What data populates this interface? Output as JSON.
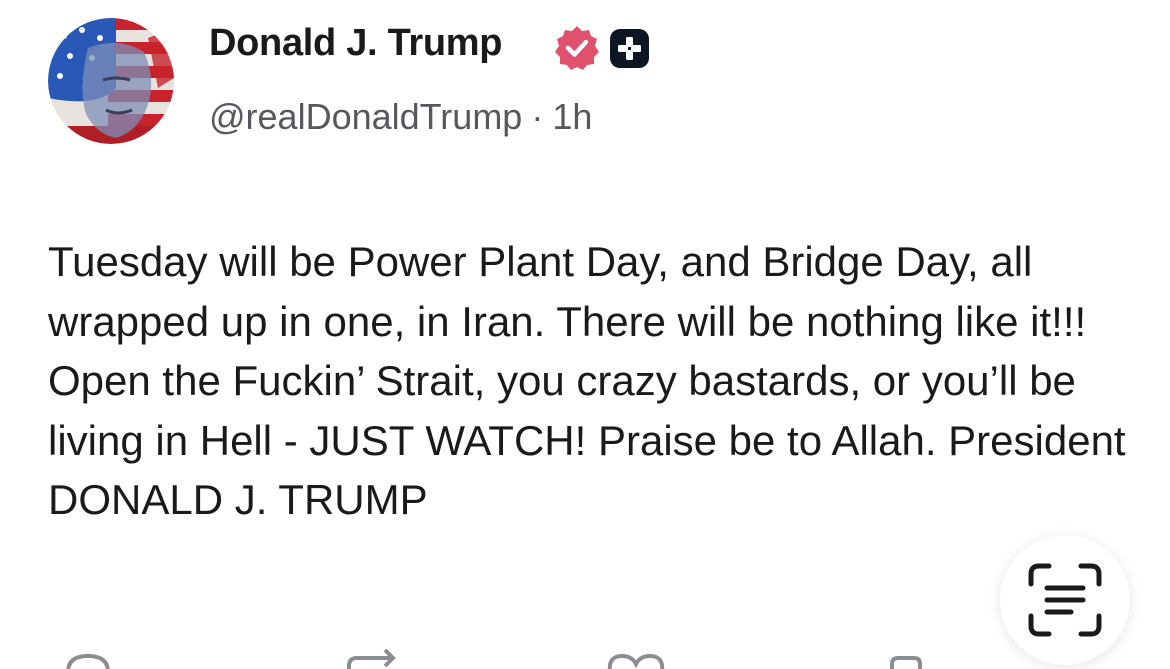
{
  "post": {
    "author": {
      "display_name": "Donald J. Trump",
      "handle": "@realDonaldTrump",
      "separator": "·",
      "time_ago": "1h",
      "avatar": "avatar-image",
      "badges": [
        "verified-badge-icon",
        "plus-badge-icon"
      ]
    },
    "body": "Tuesday will be Power Plant Day, and Bridge Day, all wrapped up in one, in Iran. There will be nothing like it!!! Open the Fuckin’ Strait, you crazy bastards, or you’ll be living in Hell - JUST WATCH! Praise be to Allah. President DONALD J. TRUMP"
  },
  "actions": [
    {
      "name": "reply",
      "icon": "reply-icon"
    },
    {
      "name": "retruth",
      "icon": "repost-icon"
    },
    {
      "name": "like",
      "icon": "heart-icon"
    },
    {
      "name": "share",
      "icon": "share-icon"
    }
  ],
  "overlay": {
    "scan_icon": "scan-text-icon"
  },
  "colors": {
    "verified": "#e0516e",
    "text": "#1a1a1a",
    "secondary_text": "#55585e"
  }
}
